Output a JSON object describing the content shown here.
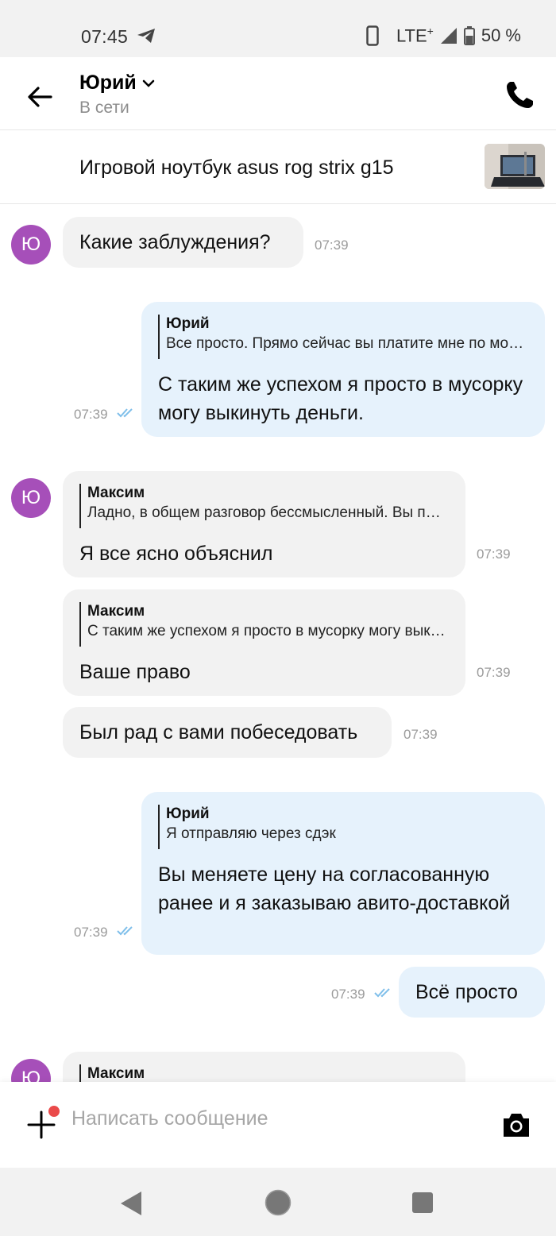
{
  "status_bar": {
    "time": "07:45",
    "network": "LTE",
    "network_plus": "+",
    "battery": "50 %",
    "icons": [
      "telegram-icon",
      "phone-device-icon",
      "signal-icon",
      "battery-icon"
    ]
  },
  "header": {
    "name": "Юрий",
    "status": "В сети",
    "icons": [
      "back-arrow-icon",
      "chevron-down-icon",
      "phone-icon"
    ]
  },
  "listing": {
    "title": "Игровой ноутбук asus rog strix g15"
  },
  "messages": [
    {
      "dir": "in",
      "avatar": "Ю",
      "text": "Какие заблуждения?",
      "time": "07:39"
    },
    {
      "dir": "out",
      "quote_author": "Юрий",
      "quote_text": "Все просто. Прямо сейчас вы платите мне по мошеннической схеме",
      "text": "С таким же успехом я просто в мусорку могу выкинуть деньги.",
      "time": "07:39"
    },
    {
      "dir": "in",
      "avatar": "Ю",
      "quote_author": "Максим",
      "quote_text": "Ладно, в общем разговор бессмысленный. Вы платите",
      "text": "Я все ясно объяснил",
      "time": "07:39"
    },
    {
      "dir": "in",
      "quote_author": "Максим",
      "quote_text": "С таким же успехом я просто в мусорку могу выкинуть деньги.",
      "text": "Ваше право",
      "time": "07:39"
    },
    {
      "dir": "in",
      "text": "Был рад с вами побеседовать",
      "time": "07:39"
    },
    {
      "dir": "out",
      "quote_author": "Юрий",
      "quote_text": "Я отправляю через сдэк",
      "text": "Вы меняете цену на согласованную ранее и я заказываю авито-доставкой",
      "time": "07:39"
    },
    {
      "dir": "out",
      "text": "Всё просто",
      "time": "07:39"
    },
    {
      "dir": "in",
      "avatar": "Ю",
      "quote_author": "Максим",
      "quote_text": "",
      "text": "",
      "time": ""
    }
  ],
  "input": {
    "placeholder": "Написать сообщение"
  },
  "colors": {
    "avatar": "#a64fb9",
    "incoming_bubble": "#f2f2f2",
    "outgoing_bubble": "#e6f2fc",
    "read_check": "#7fbfea",
    "notification_dot": "#ea4a4a"
  }
}
